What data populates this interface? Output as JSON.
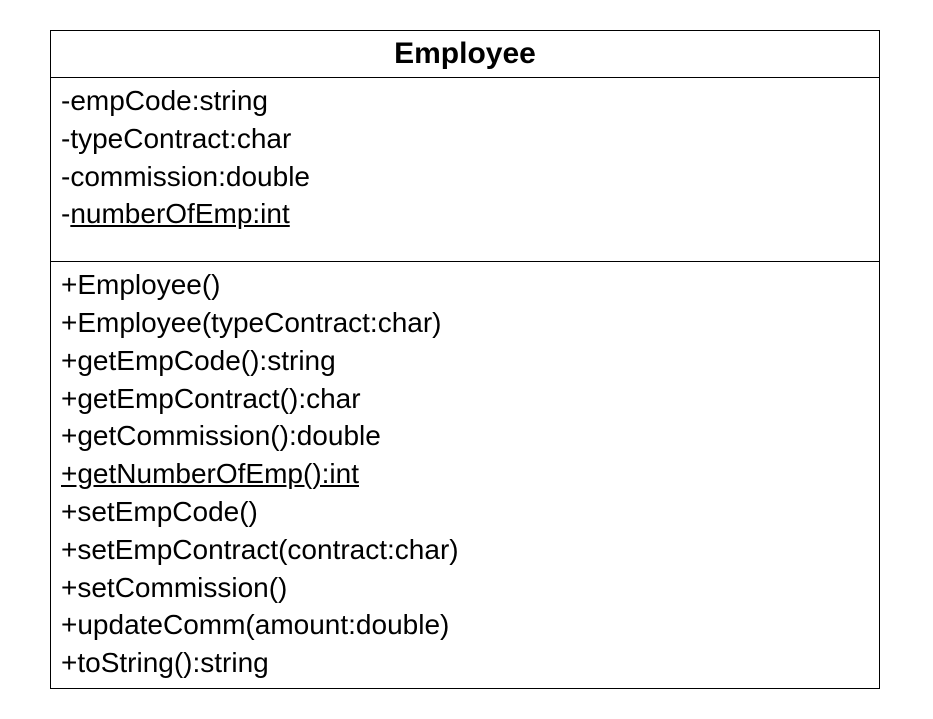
{
  "className": "Employee",
  "attributes": [
    {
      "text": "-empCode:string",
      "static": false
    },
    {
      "text": "-typeContract:char",
      "static": false
    },
    {
      "text": "-commission:double",
      "static": false
    },
    {
      "text": "-numberOfEmp:int",
      "static": true
    }
  ],
  "methods": [
    {
      "text": "+Employee()",
      "static": false
    },
    {
      "text": "+Employee(typeContract:char)",
      "static": false
    },
    {
      "text": "+getEmpCode():string",
      "static": false
    },
    {
      "text": "+getEmpContract():char",
      "static": false
    },
    {
      "text": "+getCommission():double",
      "static": false
    },
    {
      "text": "+getNumberOfEmp():int",
      "static": true
    },
    {
      "text": "+setEmpCode()",
      "static": false
    },
    {
      "text": "+setEmpContract(contract:char)",
      "static": false
    },
    {
      "text": "+setCommission()",
      "static": false
    },
    {
      "text": "+updateComm(amount:double)",
      "static": false
    },
    {
      "text": "+toString():string",
      "static": false
    }
  ]
}
